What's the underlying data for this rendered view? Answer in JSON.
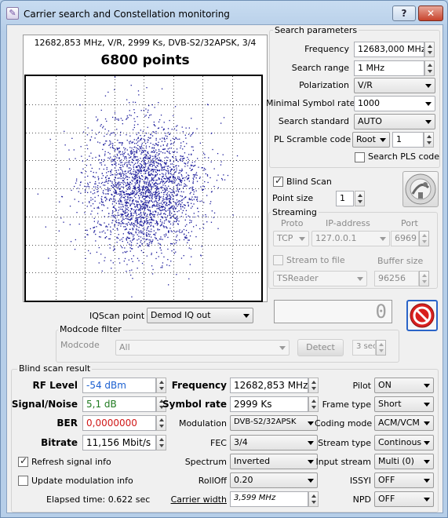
{
  "window": {
    "title": "Carrier search and Constellation monitoring",
    "help_label": "?",
    "close_label": "✕"
  },
  "plot": {
    "header": "12682,853 MHz, V/R, 2999 Ks, DVB-S2/32APSK, 3/4",
    "title": "6800 points"
  },
  "search": {
    "group_title": "Search parameters",
    "frequency_label": "Frequency",
    "frequency_value": "12683,000 MHz",
    "search_range_label": "Search range",
    "search_range_value": "1 MHz",
    "polarization_label": "Polarization",
    "polarization_value": "V/R",
    "min_symbol_rate_label": "Minimal Symbol rate",
    "min_symbol_rate_value": "1000",
    "search_standard_label": "Search standard",
    "search_standard_value": "AUTO",
    "pl_scramble_label": "PL Scramble code",
    "pl_scramble_mode": "Root",
    "pl_scramble_value": "1",
    "search_pls_label": "Search PLS code"
  },
  "blind": {
    "blind_scan_label": "Blind Scan",
    "point_size_label": "Point size",
    "point_size_value": "1"
  },
  "streaming": {
    "group_title": "Streaming",
    "proto_header": "Proto",
    "ip_header": "IP-address",
    "port_header": "Port",
    "proto_value": "TCP",
    "ip_value": "127.0.0.1",
    "port_value": "6969",
    "stream_to_file_label": "Stream to file",
    "buffer_size_label": "Buffer size",
    "file_value": "TSReader",
    "buffer_value": "96256"
  },
  "counter": {
    "value": "0"
  },
  "iqscan": {
    "label": "IQScan point",
    "value": "Demod IQ out"
  },
  "modcode": {
    "group_title": "Modcode filter",
    "label": "Modcode",
    "value": "All",
    "detect_label": "Detect",
    "timeout_value": "3 sec"
  },
  "result": {
    "group_title": "Blind scan result",
    "rf_level_label": "RF Level",
    "rf_level_value": "-54 dBm",
    "snr_label": "Signal/Noise",
    "snr_value": "5,1 dB",
    "ber_label": "BER",
    "ber_value": "0,0000000",
    "bitrate_label": "Bitrate",
    "bitrate_value": "11,156 Mbit/s",
    "refresh_label": "Refresh signal info",
    "update_mod_label": "Update modulation info",
    "elapsed_label": "Elapsed time: 0.622 sec",
    "frequency_label": "Frequency",
    "frequency_value": "12682,853 MHz",
    "symbol_rate_label": "Symbol rate",
    "symbol_rate_value": "2999 Ks",
    "modulation_label": "Modulation",
    "modulation_value": "DVB-S2/32APSK",
    "fec_label": "FEC",
    "fec_value": "3/4",
    "spectrum_label": "Spectrum",
    "spectrum_value": "Inverted",
    "rolloff_label": "RollOff",
    "rolloff_value": "0.20",
    "carrier_width_label": "Carrier width",
    "carrier_width_value": "3,599 MHz",
    "pilot_label": "Pilot",
    "pilot_value": "ON",
    "frame_type_label": "Frame type",
    "frame_type_value": "Short",
    "coding_mode_label": "Coding mode",
    "coding_mode_value": "ACM/VCM",
    "stream_type_label": "Stream type",
    "stream_type_value": "Continous",
    "input_stream_label": "Input stream",
    "input_stream_value": "Multi (0)",
    "issyi_label": "ISSYI",
    "issyi_value": "OFF",
    "npd_label": "NPD",
    "npd_value": "OFF"
  },
  "colors": {
    "point_color": "#1a1a9a",
    "rf_level_color": "#1a5fd0",
    "snr_color": "#1f7a1f",
    "ber_color": "#d01818",
    "stop_red": "#d8201e"
  },
  "icons": {
    "stop": "stop-icon",
    "satellite": "satellite-dish-icon"
  }
}
